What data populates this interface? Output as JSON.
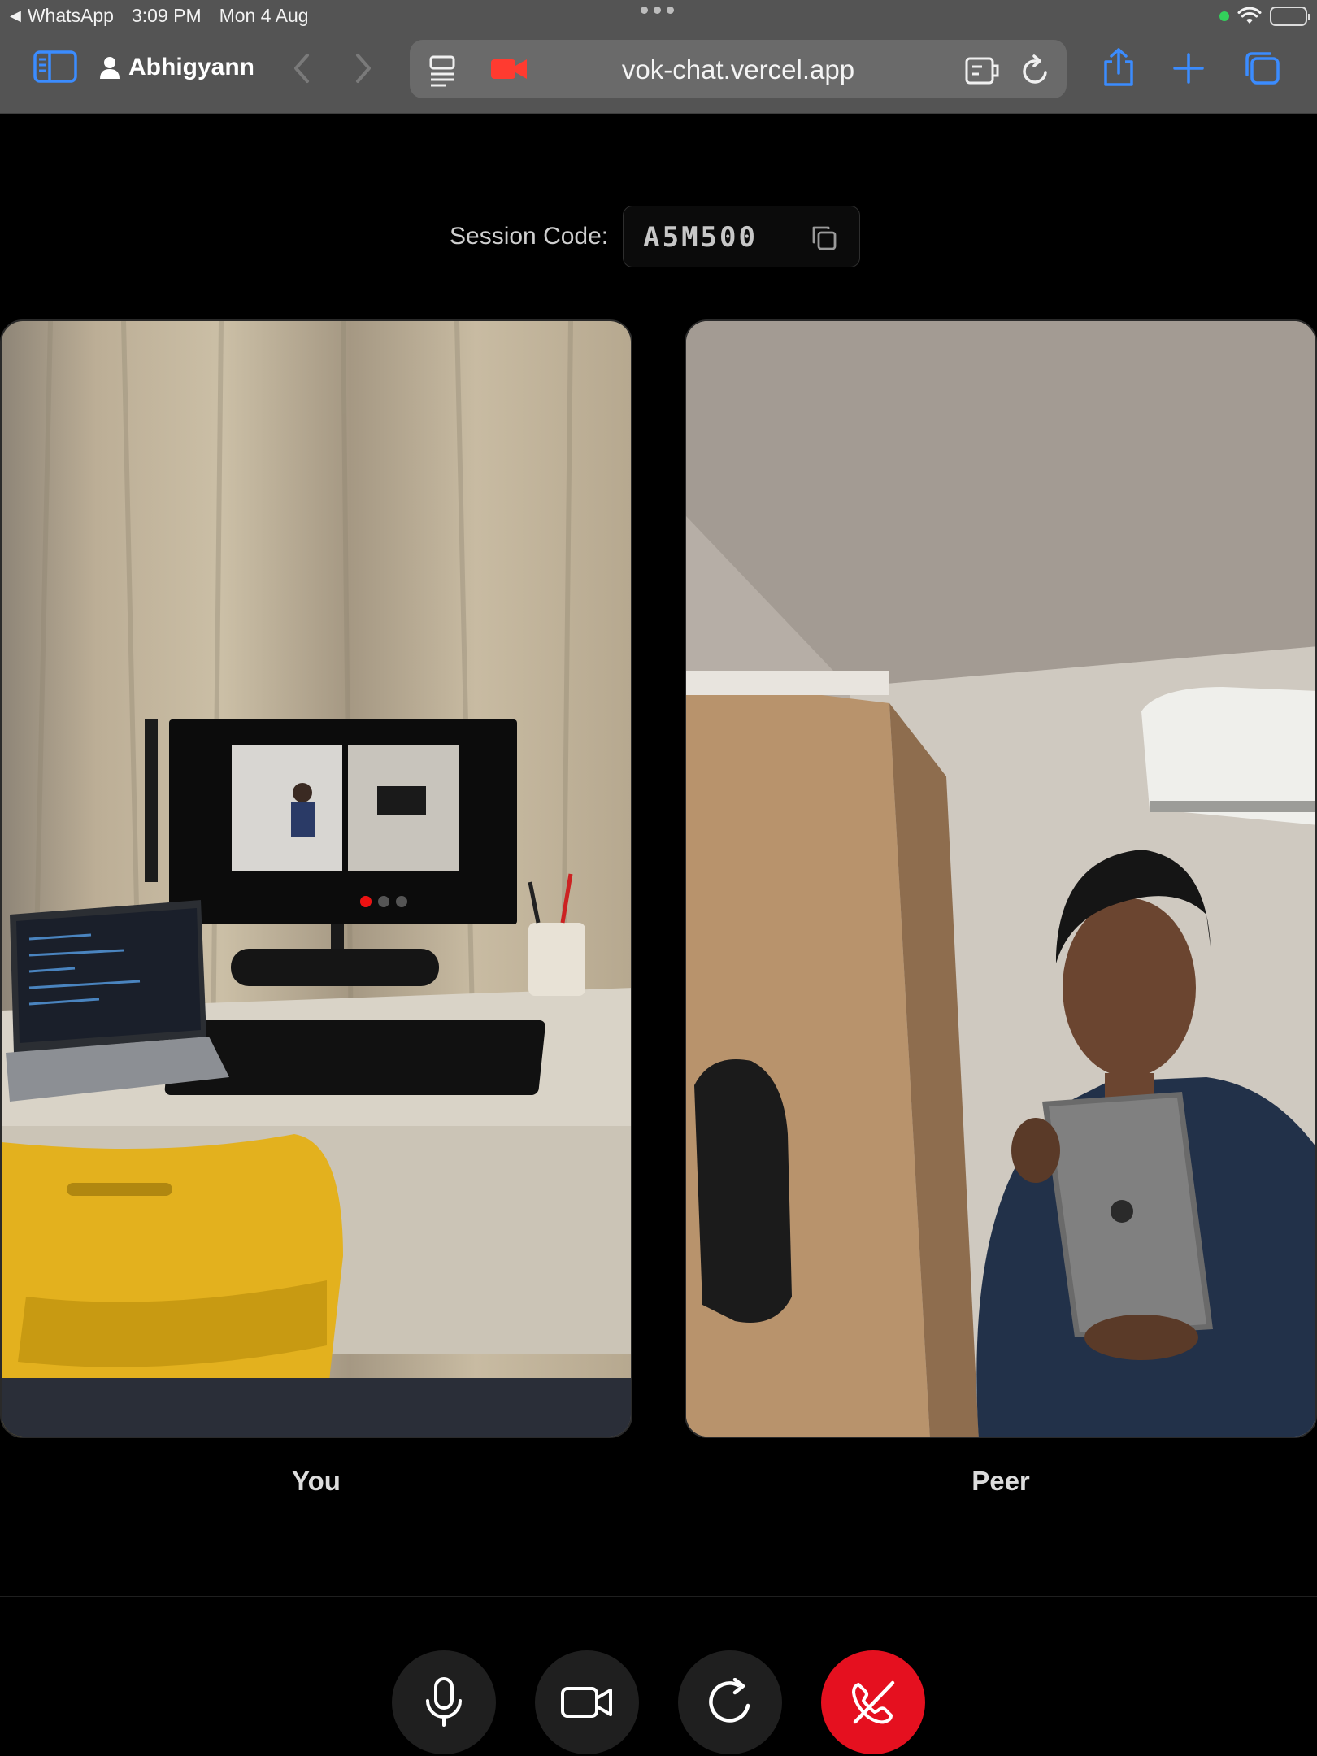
{
  "status_bar": {
    "back_app": "WhatsApp",
    "time": "3:09 PM",
    "date": "Mon 4 Aug"
  },
  "browser": {
    "profile_name": "Abhigyann",
    "url": "vok-chat.vercel.app",
    "icons": [
      "sidebar-icon",
      "person-icon",
      "back-icon",
      "forward-icon",
      "reader-icon",
      "camera-in-use-icon",
      "extension-icon",
      "reload-icon",
      "share-icon",
      "new-tab-icon",
      "tabs-icon"
    ]
  },
  "session": {
    "label": "Session Code:",
    "code": "A5M500"
  },
  "videos": {
    "local_label": "You",
    "remote_label": "Peer"
  },
  "controls": {
    "items": [
      "microphone-icon",
      "camera-icon",
      "switch-camera-icon",
      "end-call-icon"
    ],
    "end_color": "#e5101f"
  }
}
